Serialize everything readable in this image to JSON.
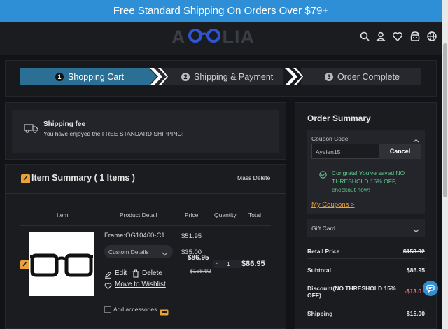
{
  "banner": {
    "text": "Free Standard Shipping On Orders Over $79+"
  },
  "header": {
    "logo_left": "A",
    "logo_right": "LIA"
  },
  "steps": [
    {
      "num": "1",
      "label": "Shopping Cart"
    },
    {
      "num": "2",
      "label": "Shipping & Payment"
    },
    {
      "num": "3",
      "label": "Order Complete"
    }
  ],
  "shipping": {
    "title": "Shipping fee",
    "text": "You have enjoyed the FREE STANDARD SHIPPING!"
  },
  "items": {
    "title": "Item Summary ( 1 Items )",
    "mass_delete": "Mass Delete",
    "columns": {
      "item": "Item",
      "product": "Product Detail",
      "price": "Price",
      "quantity": "Quantity",
      "total": "Total"
    },
    "row": {
      "frame": "Frame:OG10460-C1",
      "frame_price": "$51.95",
      "custom": "Custom Details",
      "custom_price": "$35.00",
      "price": "$86.95",
      "old_price": "$158.92",
      "qty": "1",
      "total": "$86.95",
      "edit": "Edit",
      "delete": "Delete",
      "wishlist": "Move to Wishlist",
      "accessories": "Add accessories"
    }
  },
  "order": {
    "title": "Order Summary",
    "coupon_label": "Coupon Code",
    "coupon_value": "Ayelen15",
    "cancel": "Cancel",
    "congrats": [
      "Congrats! You've saved NO",
      "THRESHOLD 15% OFF,",
      "checkout now!"
    ],
    "my_coupons": "My Coupons >",
    "gift_card": "Gift Card",
    "retail_label": "Retail Price",
    "retail_value": "$158.92",
    "subtotal_label": "Subtotal",
    "subtotal_value": "$86.95",
    "discount_label_1": "Discount(NO THRESHOLD 15%",
    "discount_label_2": "OFF)",
    "discount_value": "-$13.0",
    "shipping_label": "Shipping",
    "shipping_value": "$15.00"
  },
  "colors": {
    "accent": "#2e8fd6",
    "step_active": "#2b6f95",
    "orange": "#e8a23a",
    "green": "#5cc98a",
    "red": "#ff6b6b"
  }
}
